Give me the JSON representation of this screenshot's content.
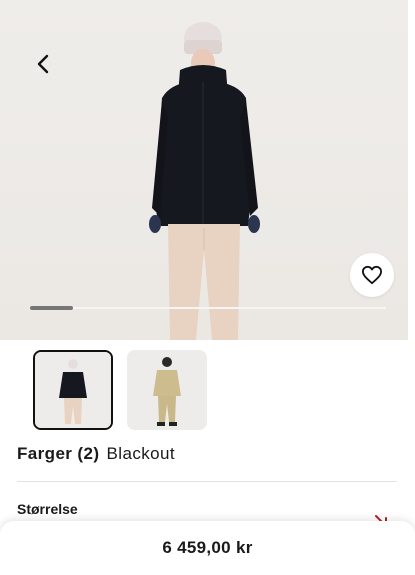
{
  "product": {
    "color_label": "Farger (2)",
    "color_value": "Blackout",
    "size_label": "Størrelse",
    "price": "6 459,00 kr"
  },
  "gallery": {
    "progress": 0.12,
    "thumbnails": [
      "blackout-jacket",
      "beige-outfit"
    ]
  },
  "icons": {
    "back": "chevron-left-icon",
    "favorite": "heart-icon"
  },
  "colors": {
    "accent_arrow": "#b3202a",
    "jacket": "#16181f",
    "pants": "#e8d3c3"
  }
}
